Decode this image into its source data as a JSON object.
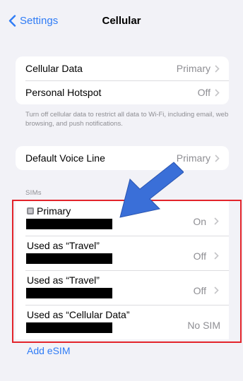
{
  "navbar": {
    "back_label": "Settings",
    "title": "Cellular"
  },
  "group1": {
    "rows": [
      {
        "label": "Cellular Data",
        "value": "Primary"
      },
      {
        "label": "Personal Hotspot",
        "value": "Off"
      }
    ],
    "footer": "Turn off cellular data to restrict all data to Wi-Fi, including email, web browsing, and push notifications."
  },
  "group2": {
    "rows": [
      {
        "label": "Default Voice Line",
        "value": "Primary"
      }
    ]
  },
  "sims": {
    "header": "SIMs",
    "rows": [
      {
        "label": "Primary",
        "value": "On"
      },
      {
        "label": "Used as “Travel”",
        "value": "Off"
      },
      {
        "label": "Used as “Travel”",
        "value": "Off"
      },
      {
        "label": "Used as “Cellular Data”",
        "value": "No SIM"
      }
    ]
  },
  "add_esim_label": "Add eSIM",
  "annotation": {
    "arrow_color": "#3a6fd8",
    "highlight_color": "#e3242b"
  },
  "icons": {
    "back": "chevron-left-icon",
    "disclosure": "chevron-right-icon",
    "sim": "sim-card-icon"
  }
}
